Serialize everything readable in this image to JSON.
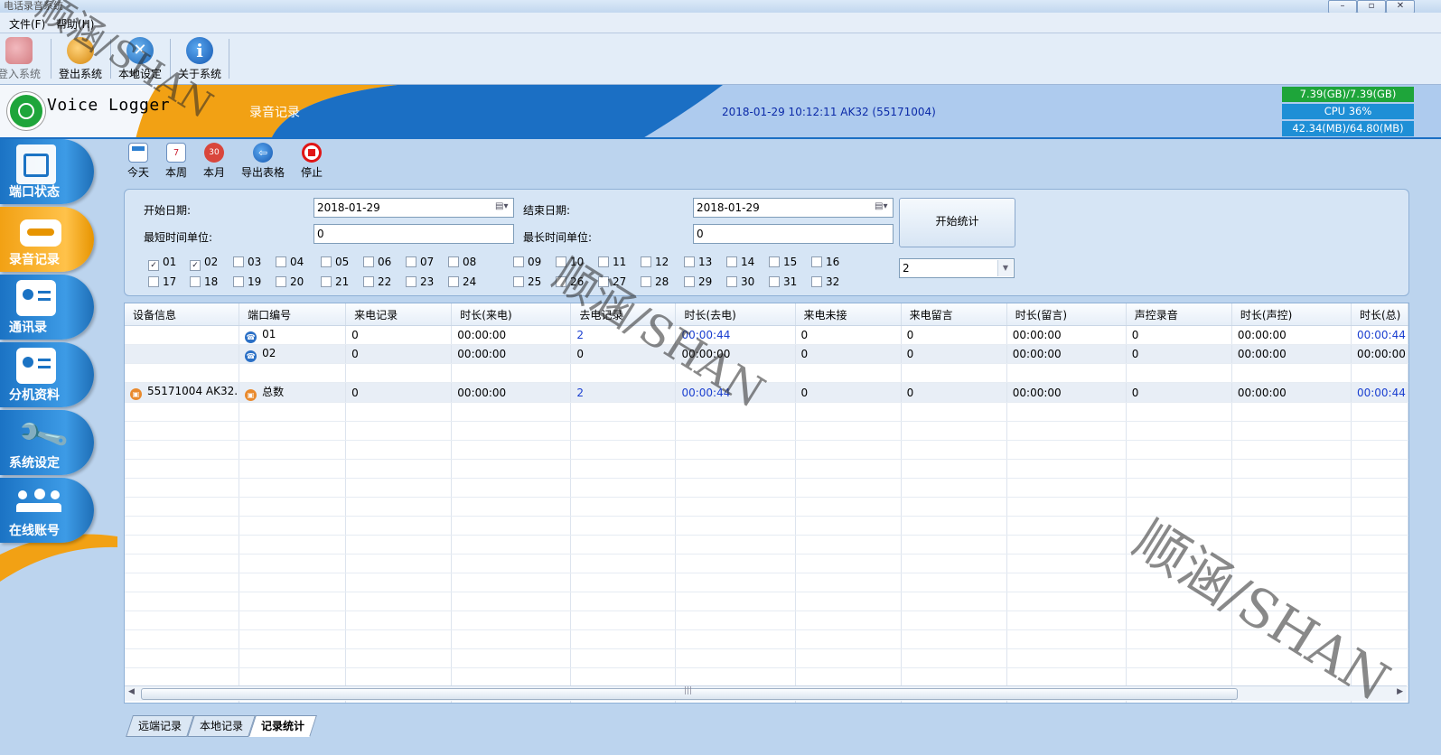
{
  "window": {
    "title": "电话录音系统",
    "controls": [
      "min",
      "max",
      "close"
    ]
  },
  "menu": [
    {
      "label": "文件(F)"
    },
    {
      "label": "帮助(H)"
    }
  ],
  "toolbar": [
    {
      "label": "登入系统",
      "icon": "login-icon"
    },
    {
      "label": "登出系统",
      "icon": "logout-icon"
    },
    {
      "label": "本地设定",
      "icon": "tools-icon"
    },
    {
      "label": "关于系统",
      "icon": "info-icon"
    }
  ],
  "banner": {
    "app_name": "Voice Logger",
    "section_title": "录音记录",
    "status_line": "2018-01-29 10:12:11 AK32 (55171004)",
    "sysinfo": [
      "7.39(GB)/7.39(GB)",
      "CPU 36%",
      "42.34(MB)/64.80(MB)"
    ],
    "colors": {
      "disk": "#1ea53a",
      "cpu": "#1e8fd6",
      "mem": "#1e8fd6",
      "accent": "#f2a114"
    }
  },
  "nav": [
    {
      "label": "端口状态",
      "icon": "port-status-icon",
      "active": false
    },
    {
      "label": "录音记录",
      "icon": "recording-icon",
      "active": true
    },
    {
      "label": "通讯录",
      "icon": "contacts-icon",
      "active": false
    },
    {
      "label": "分机资料",
      "icon": "extension-icon",
      "active": false
    },
    {
      "label": "系统设定",
      "icon": "wrench-icon",
      "active": false
    },
    {
      "label": "在线账号",
      "icon": "online-users-icon",
      "active": false
    }
  ],
  "subtoolbar": [
    {
      "label": "今天",
      "icon": "today-icon"
    },
    {
      "label": "本周",
      "icon": "week-icon"
    },
    {
      "label": "本月",
      "icon": "month-icon"
    },
    {
      "label": "导出表格",
      "icon": "export-icon"
    },
    {
      "label": "停止",
      "icon": "stop-icon"
    }
  ],
  "filter": {
    "start_label": "开始日期:",
    "start_value": "2018-01-29",
    "end_label": "结束日期:",
    "end_value": "2018-01-29",
    "min_label": "最短时间单位:",
    "min_value": "0",
    "max_label": "最长时间单位:",
    "max_value": "0",
    "start_button": "开始统计",
    "select_value": "2",
    "ports_row1": [
      "01",
      "02",
      "03",
      "04",
      "05",
      "06",
      "07",
      "08",
      "09",
      "10",
      "11",
      "12",
      "13",
      "14",
      "15",
      "16"
    ],
    "ports_row2": [
      "17",
      "18",
      "19",
      "20",
      "21",
      "22",
      "23",
      "24",
      "25",
      "26",
      "27",
      "28",
      "29",
      "30",
      "31",
      "32"
    ],
    "checked": [
      "01",
      "02"
    ]
  },
  "table": {
    "columns": [
      "设备信息",
      "端口编号",
      "来电记录",
      "时长(来电)",
      "去电记录",
      "时长(去电)",
      "来电未接",
      "来电留言",
      "时长(留言)",
      "声控录音",
      "时长(声控)",
      "时长(总)"
    ],
    "rows": [
      {
        "cells": [
          "",
          "01",
          "0",
          "00:00:00",
          "2",
          "00:00:44",
          "0",
          "0",
          "00:00:00",
          "0",
          "00:00:00",
          "00:00:44"
        ],
        "icon": "phone"
      },
      {
        "cells": [
          "",
          "02",
          "0",
          "00:00:00",
          "0",
          "00:00:00",
          "0",
          "0",
          "00:00:00",
          "0",
          "00:00:00",
          "00:00:00"
        ],
        "icon": "phone"
      },
      {
        "cells": [
          "",
          "",
          "",
          "",
          "",
          "",
          "",
          "",
          "",
          "",
          "",
          ""
        ],
        "icon": ""
      },
      {
        "cells": [
          "55171004 AK32.",
          "总数",
          "0",
          "00:00:00",
          "2",
          "00:00:44",
          "0",
          "0",
          "00:00:00",
          "0",
          "00:00:00",
          "00:00:44"
        ],
        "icon": "total"
      }
    ]
  },
  "tabs": [
    {
      "label": "远端记录"
    },
    {
      "label": "本地记录"
    },
    {
      "label": "记录统计",
      "active": true
    }
  ],
  "watermark": {
    "text": "顺涵/SHAN"
  }
}
